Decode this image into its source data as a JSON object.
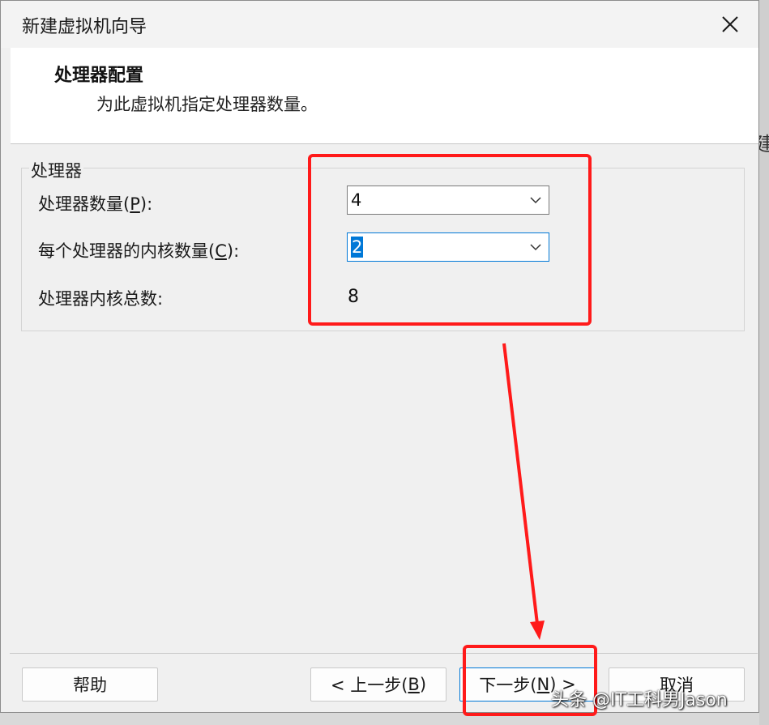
{
  "window": {
    "title": "新建虚拟机向导"
  },
  "header": {
    "title": "处理器配置",
    "subtitle": "为此虚拟机指定处理器数量。"
  },
  "processor_group": {
    "legend": "处理器",
    "processor_count_label": "处理器数量(",
    "processor_count_key": "P",
    "processor_count_suffix": "):",
    "processor_count_value": "4",
    "cores_per_processor_label": "每个处理器的内核数量(",
    "cores_per_processor_key": "C",
    "cores_per_processor_suffix": "):",
    "cores_per_processor_value": "2",
    "total_cores_label": "处理器内核总数:",
    "total_cores_value": "8"
  },
  "footer": {
    "help_label": "帮助",
    "back_label": "< 上一步(",
    "back_key": "B",
    "back_suffix": ")",
    "next_label": "下一步(",
    "next_key": "N",
    "next_suffix": ") >",
    "cancel_label": "取消"
  },
  "side_glyph": "建",
  "watermark": "头条 @IT工科男Jason",
  "colors": {
    "annotation": "#ff1a1a",
    "accent": "#0078d7"
  }
}
